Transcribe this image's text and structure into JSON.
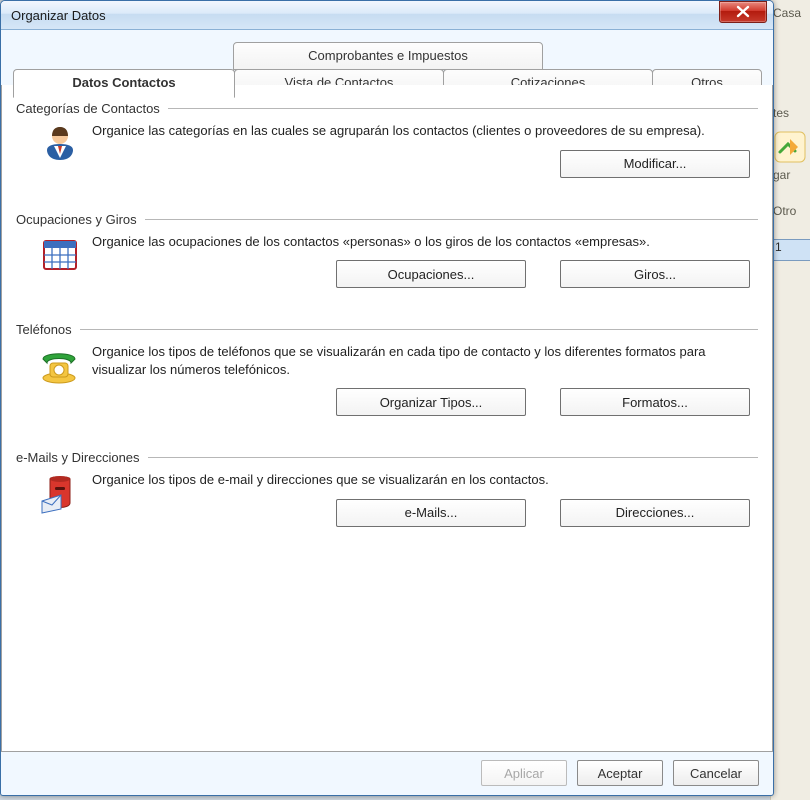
{
  "window": {
    "title": "Organizar Datos"
  },
  "tabs": {
    "top_row": [
      {
        "label": "Comprobantes e Impuestos"
      }
    ],
    "bottom_row": [
      {
        "label": "Datos Contactos",
        "active": true
      },
      {
        "label": "Vista de Contactos"
      },
      {
        "label": "Cotizaciones"
      },
      {
        "label": "Otros"
      }
    ]
  },
  "groups": {
    "categorias": {
      "title": "Categorías de Contactos",
      "desc": "Organice las categorías en las cuales se agruparán los contactos (clientes o proveedores de su empresa).",
      "buttons": {
        "modificar": "Modificar..."
      }
    },
    "ocupaciones": {
      "title": "Ocupaciones y Giros",
      "desc": "Organice las ocupaciones de los contactos «personas» o los giros de los contactos «empresas».",
      "buttons": {
        "ocupaciones": "Ocupaciones...",
        "giros": "Giros..."
      }
    },
    "telefonos": {
      "title": "Teléfonos",
      "desc": "Organice los tipos de teléfonos que se visualizarán en cada tipo de contacto y los diferentes formatos para visualizar los números telefónicos.",
      "buttons": {
        "tipos": "Organizar Tipos...",
        "formatos": "Formatos..."
      }
    },
    "emails": {
      "title": "e-Mails y Direcciones",
      "desc": "Organice los tipos de e-mail y direcciones que se visualizarán en los contactos.",
      "buttons": {
        "emails": "e-Mails...",
        "direcciones": "Direcciones..."
      }
    }
  },
  "dialog_buttons": {
    "aplicar": "Aplicar",
    "aceptar": "Aceptar",
    "cancelar": "Cancelar"
  },
  "background": {
    "label1": "Casa",
    "label2": "tes",
    "label3": "gar",
    "label4": "Otro",
    "cell1": "1"
  }
}
